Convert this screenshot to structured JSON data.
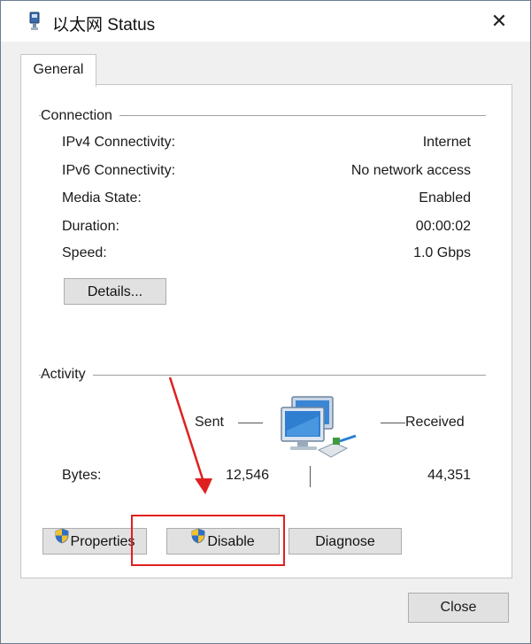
{
  "window": {
    "title": "以太网 Status",
    "close_glyph": "✕"
  },
  "tabs": [
    {
      "label": "General"
    }
  ],
  "connection": {
    "section_label": "Connection",
    "rows": [
      {
        "label": "IPv4 Connectivity:",
        "value": "Internet"
      },
      {
        "label": "IPv6 Connectivity:",
        "value": "No network access"
      },
      {
        "label": "Media State:",
        "value": "Enabled"
      },
      {
        "label": "Duration:",
        "value": "00:00:02"
      },
      {
        "label": "Speed:",
        "value": "1.0 Gbps"
      }
    ],
    "details_button": "Details..."
  },
  "activity": {
    "section_label": "Activity",
    "sent_label": "Sent",
    "received_label": "Received",
    "bytes_label": "Bytes:",
    "bytes_sent": "12,546",
    "bytes_received": "44,351"
  },
  "buttons": {
    "properties": "Properties",
    "disable": "Disable",
    "diagnose": "Diagnose",
    "close": "Close"
  },
  "annotation": {
    "color": "#e02020",
    "target": "disable-button"
  },
  "icons": [
    "ethernet-icon",
    "network-computers-icon",
    "shield-icon"
  ]
}
